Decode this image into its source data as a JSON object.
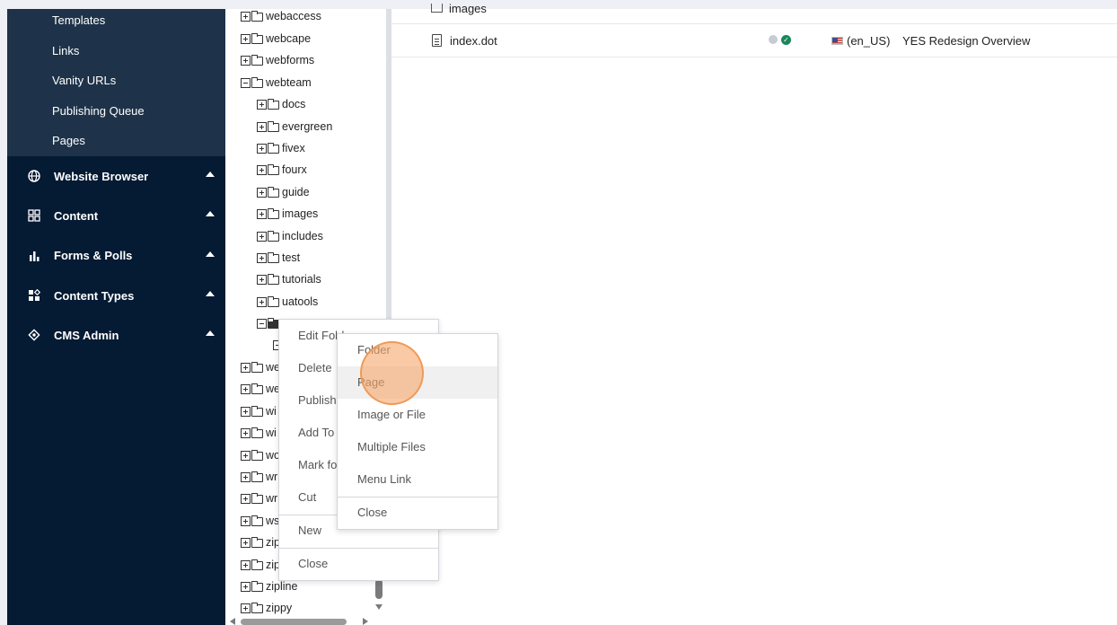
{
  "sidebar": {
    "sub_items": [
      "Templates",
      "Links",
      "Vanity URLs",
      "Publishing Queue",
      "Pages"
    ],
    "nav": [
      {
        "label": "Website Browser",
        "icon": "globe-icon"
      },
      {
        "label": "Content",
        "icon": "grid-icon"
      },
      {
        "label": "Forms & Polls",
        "icon": "bar-chart-icon"
      },
      {
        "label": "Content Types",
        "icon": "content-types-icon"
      },
      {
        "label": "CMS Admin",
        "icon": "admin-icon"
      }
    ]
  },
  "tree": {
    "items": [
      {
        "label": "webaccess"
      },
      {
        "label": "webcape"
      },
      {
        "label": "webforms"
      },
      {
        "label": "webteam"
      },
      {
        "label": "docs"
      },
      {
        "label": "evergreen"
      },
      {
        "label": "fivex"
      },
      {
        "label": "fourx"
      },
      {
        "label": "guide"
      },
      {
        "label": "images"
      },
      {
        "label": "includes"
      },
      {
        "label": "test"
      },
      {
        "label": "tutorials"
      },
      {
        "label": "uatools"
      },
      {
        "label": ""
      },
      {
        "label": ""
      },
      {
        "label": "we"
      },
      {
        "label": "we"
      },
      {
        "label": "wi"
      },
      {
        "label": "wi"
      },
      {
        "label": "wo"
      },
      {
        "label": "wr"
      },
      {
        "label": "wr"
      },
      {
        "label": "ws"
      },
      {
        "label": "zip"
      },
      {
        "label": "zip"
      },
      {
        "label": "zipline"
      },
      {
        "label": "zippy"
      }
    ]
  },
  "listing": {
    "partial_row": "images",
    "rows": [
      {
        "name": "index.dot",
        "language": "(en_US)",
        "title": "YES Redesign Overview"
      }
    ]
  },
  "context_menu": {
    "items": [
      "Edit Fold",
      "Delete",
      "Publish (",
      "Add To B",
      "Mark for",
      "Cut",
      "New",
      "Close"
    ]
  },
  "new_submenu": {
    "items": [
      "Folder",
      "Page",
      "Image or File",
      "Multiple Files",
      "Menu Link",
      "Close"
    ]
  }
}
